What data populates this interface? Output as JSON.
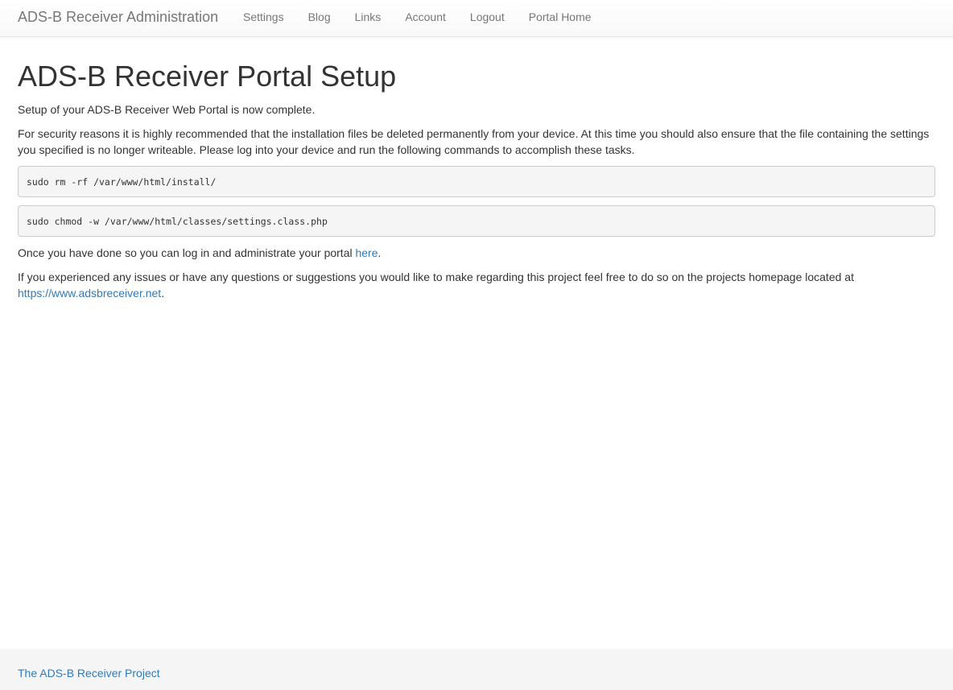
{
  "navbar": {
    "brand": "ADS-B Receiver Administration",
    "items": [
      {
        "label": "Settings"
      },
      {
        "label": "Blog"
      },
      {
        "label": "Links"
      },
      {
        "label": "Account"
      },
      {
        "label": "Logout"
      },
      {
        "label": "Portal Home"
      }
    ]
  },
  "main": {
    "title": "ADS-B Receiver Portal Setup",
    "intro": "Setup of your ADS-B Receiver Web Portal is now complete.",
    "security_text": "For security reasons it is highly recommended that the installation files be deleted permanently from your device. At this time you should also ensure that the file containing the settings you specified is no longer writeable. Please log into your device and run the following commands to accomplish these tasks.",
    "commands": [
      "sudo rm -rf /var/www/html/install/",
      "sudo chmod -w /var/www/html/classes/settings.class.php"
    ],
    "admin_text_before": "Once you have done so you can log in and administrate your portal ",
    "admin_link": "here",
    "admin_text_after": ".",
    "issues_text": "If you experienced any issues or have any questions or suggestions you would like to make regarding this project feel free to do so on the projects homepage located at ",
    "homepage_link": "https://www.adsbreceiver.net",
    "issues_text_after": "."
  },
  "footer": {
    "link": "The ADS-B Receiver Project"
  },
  "colors": {
    "link": "#337ab7",
    "nav_text": "#777777",
    "pre_background": "#f5f5f5",
    "footer_background": "#f5f5f5"
  }
}
